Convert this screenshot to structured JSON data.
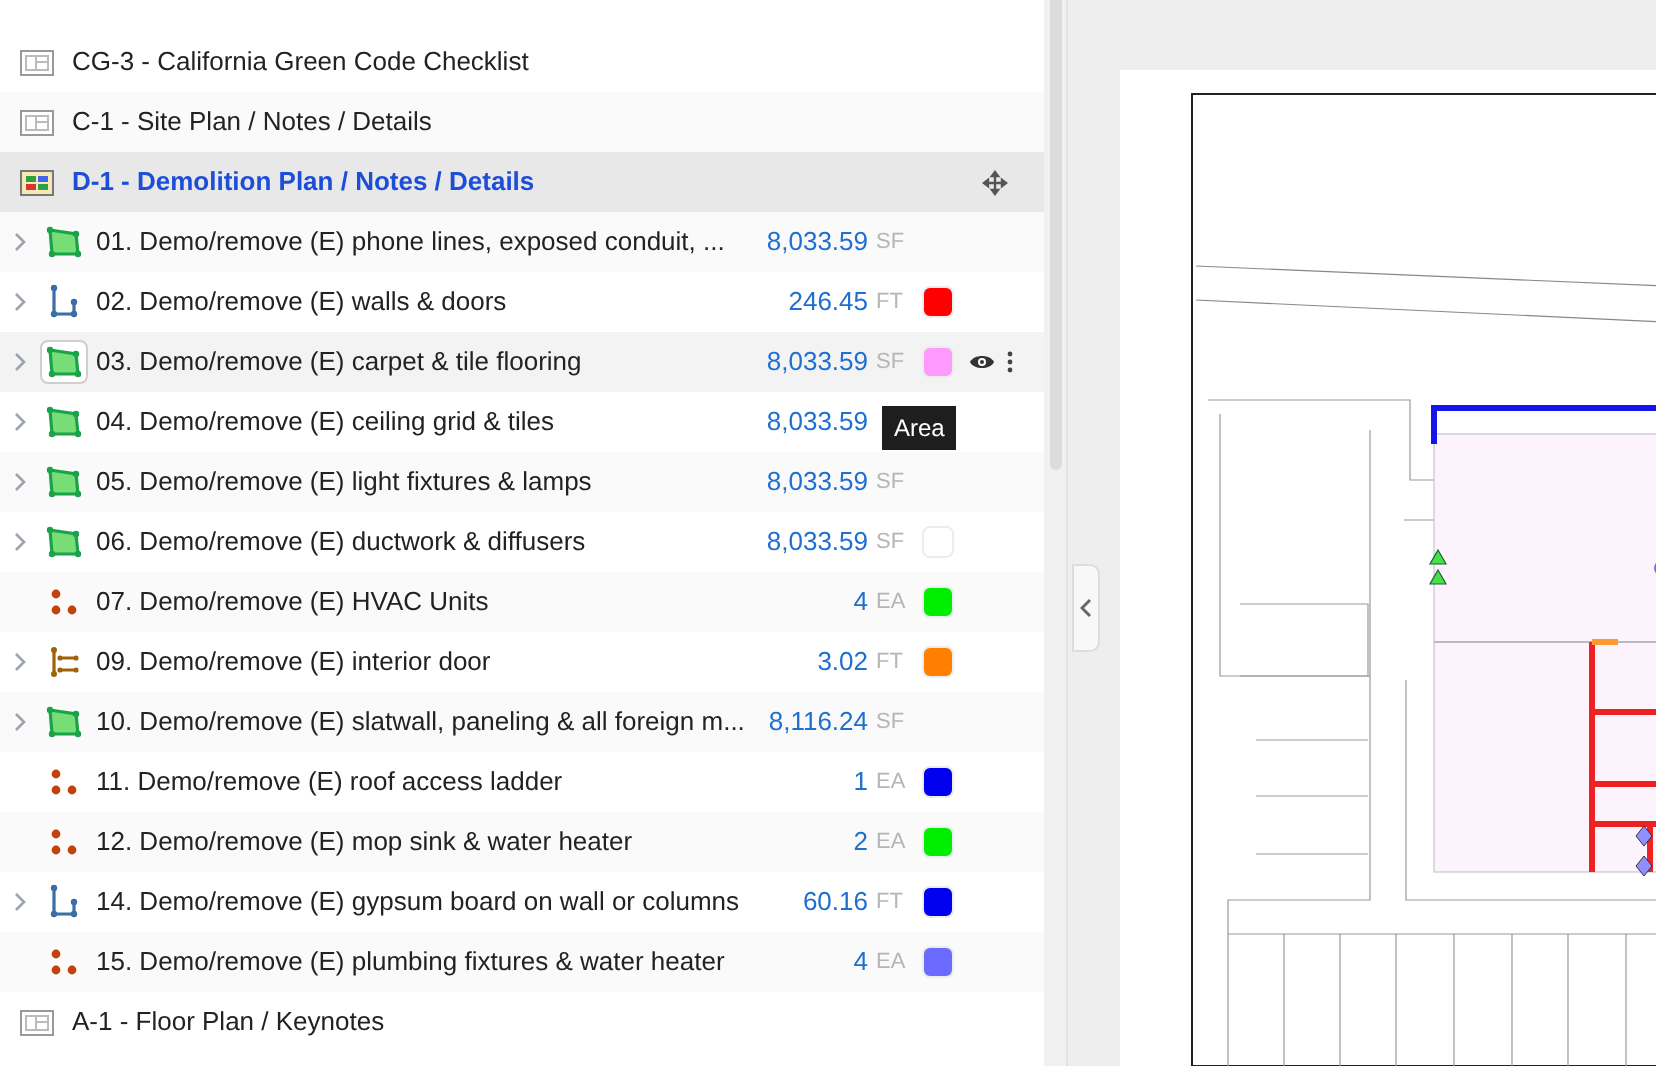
{
  "rows": [
    {
      "kind": "sheet",
      "label": "CG-3 - California Green Code Checklist",
      "selected": false
    },
    {
      "kind": "sheet",
      "label": "C-1 - Site Plan / Notes / Details",
      "selected": false
    },
    {
      "kind": "sheet",
      "label": "D-1 - Demolition Plan / Notes / Details",
      "selected": true
    },
    {
      "kind": "area",
      "label": "01. Demo/remove (E) phone lines, exposed conduit, ...",
      "value": "8,033.59",
      "unit": "SF",
      "expandable": true,
      "hovered": false
    },
    {
      "kind": "linear",
      "label": "02. Demo/remove (E) walls & doors",
      "value": "246.45",
      "unit": "FT",
      "color": "#ff0000",
      "expandable": true,
      "hovered": false
    },
    {
      "kind": "area",
      "label": "03. Demo/remove (E) carpet & tile flooring",
      "value": "8,033.59",
      "unit": "SF",
      "color": "#ff99ff",
      "expandable": true,
      "hovered": true
    },
    {
      "kind": "area",
      "label": "04. Demo/remove (E) ceiling grid & tiles",
      "value": "8,033.59",
      "expandable": true,
      "hovered": false,
      "tooltip": "Area"
    },
    {
      "kind": "area",
      "label": "05. Demo/remove (E) light fixtures & lamps",
      "value": "8,033.59",
      "unit": "SF",
      "expandable": true,
      "hovered": false
    },
    {
      "kind": "area",
      "label": "06. Demo/remove (E) ductwork & diffusers",
      "value": "8,033.59",
      "unit": "SF",
      "color": "#ffffff",
      "expandable": true,
      "hovered": false
    },
    {
      "kind": "count",
      "label": "07. Demo/remove (E) HVAC Units",
      "value": "4",
      "unit": "EA",
      "color": "#00ee00",
      "expandable": false,
      "hovered": false
    },
    {
      "kind": "segment",
      "label": "09. Demo/remove (E) interior door",
      "value": "3.02",
      "unit": "FT",
      "color": "#ff8000",
      "expandable": true,
      "hovered": false
    },
    {
      "kind": "area",
      "label": "10. Demo/remove (E) slatwall, paneling & all foreign m...",
      "value": "8,116.24",
      "unit": "SF",
      "expandable": true,
      "hovered": false
    },
    {
      "kind": "count",
      "label": "11. Demo/remove (E) roof access ladder",
      "value": "1",
      "unit": "EA",
      "color": "#0000ee",
      "expandable": false,
      "hovered": false
    },
    {
      "kind": "count",
      "label": "12. Demo/remove (E) mop sink & water heater",
      "value": "2",
      "unit": "EA",
      "color": "#00ee00",
      "expandable": false,
      "hovered": false
    },
    {
      "kind": "linear",
      "label": "14. Demo/remove (E) gypsum board on wall or columns",
      "value": "60.16",
      "unit": "FT",
      "color": "#0000ee",
      "expandable": true,
      "hovered": false
    },
    {
      "kind": "count",
      "label": "15. Demo/remove (E) plumbing fixtures & water heater",
      "value": "4",
      "unit": "EA",
      "color": "#6b6bff",
      "expandable": false,
      "hovered": false
    },
    {
      "kind": "sheet",
      "label": "A-1 - Floor Plan / Keynotes",
      "selected": false
    }
  ]
}
